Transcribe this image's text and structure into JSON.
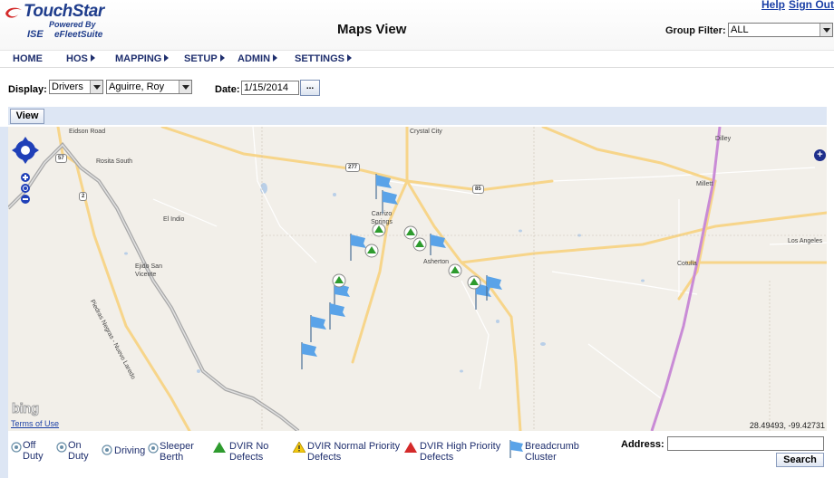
{
  "header": {
    "logo_brand": "TouchStar",
    "logo_powered": "Powered By",
    "logo_ise": "ISE",
    "logo_suite": "eFleetSuite",
    "page_title": "Maps View",
    "help_link": "Help",
    "signout_link": "Sign Out",
    "group_filter_label": "Group Filter:",
    "group_filter_value": "ALL"
  },
  "nav": {
    "items": [
      {
        "label": "HOME",
        "has_menu": false
      },
      {
        "label": "HOS",
        "has_menu": true
      },
      {
        "label": "MAPPING",
        "has_menu": true
      },
      {
        "label": "SETUP",
        "has_menu": true
      },
      {
        "label": "ADMIN",
        "has_menu": true
      },
      {
        "label": "SETTINGS",
        "has_menu": true
      }
    ]
  },
  "controls": {
    "display_label": "Display:",
    "display_value": "Drivers",
    "driver_value": "Aguirre, Roy",
    "date_label": "Date:",
    "date_value": "1/15/2014",
    "date_button": "...",
    "view_button": "View"
  },
  "map": {
    "towns": [
      "Eidson Road",
      "Crystal City",
      "Dilley",
      "Rosita South",
      "Millett",
      "El Indio",
      "Carrizo Springs",
      "Los Angeles",
      "Ejido San Vicente",
      "Asherton",
      "Cotulla",
      "Piedras Negras - Nuevo Laredo"
    ],
    "shields": [
      "277",
      "85",
      "2",
      "57"
    ],
    "bing_logo": "bing",
    "terms_link": "Terms of Use",
    "coordinates": "28.49493, -99.42731",
    "colors": {
      "background": "#f2efe9",
      "highway": "#f7d58a",
      "interstate": "#c98bd6",
      "river": "#a8a8a8",
      "flag": "#5aa3e8",
      "dvir_no_defects": "#2e9b2e"
    }
  },
  "legend": {
    "off_duty": "Off Duty",
    "on_duty": "On Duty",
    "driving": "Driving",
    "sleeper": "Sleeper Berth",
    "dvir_no": "DVIR No Defects",
    "dvir_normal": "DVIR Normal Priority Defects",
    "dvir_high": "DVIR High Priority Defects",
    "breadcrumb": "Breadcrumb Cluster",
    "address_label": "Address:",
    "address_value": "",
    "search_button": "Search"
  }
}
